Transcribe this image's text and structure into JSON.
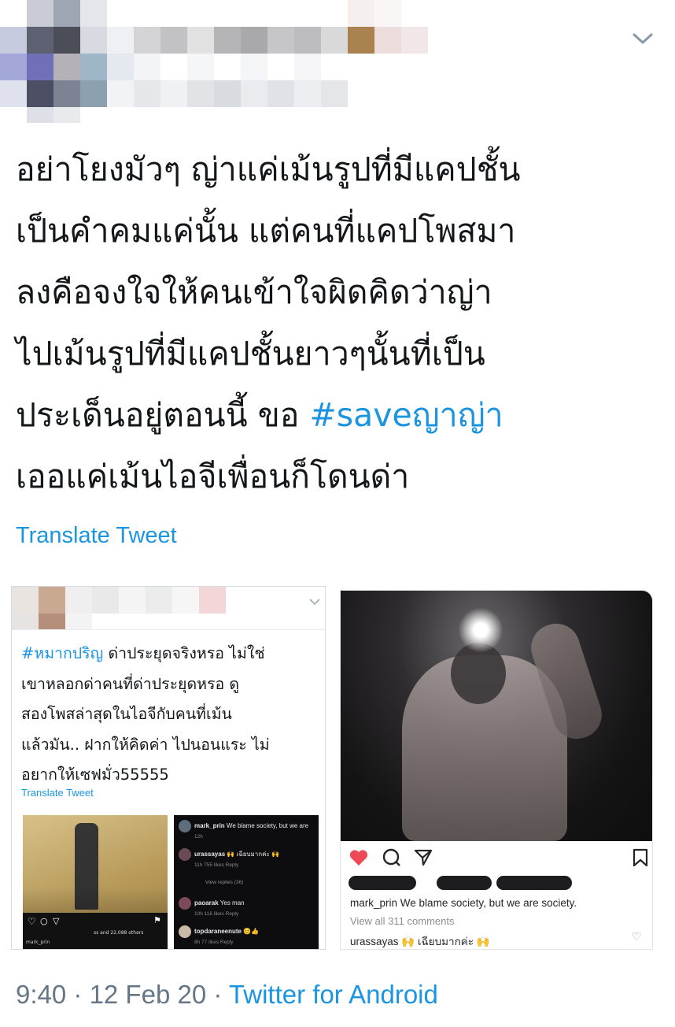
{
  "tweet": {
    "lines": [
      "อย่าโยงมัวๆ ญ่าแค่เม้นรูปที่มีแคปชั้น",
      "เป็นคำคมแค่นั้น แต่คนที่แคปโพสมา",
      "ลงคือจงใจให้คนเข้าใจผิดคิดว่าญ่า",
      "ไปเม้นรูปที่มีแคปชั้นยาวๆนั้นที่เป็น",
      "ประเด็นอยู่ตอนนี้ ขอ ",
      "เออแค่เม้นไอจีเพื่อนก็โดนด่า"
    ],
    "hashtag": "#saveญาญ่า",
    "translate_label": "Translate Tweet",
    "time": "9:40",
    "sep1": " · ",
    "date": "12 Feb 20",
    "sep2": " · ",
    "source": "Twitter for Android"
  },
  "embedded_tweet": {
    "hashtag": "#หมากปริญ",
    "line1_rest": " ด่าประยุดจริงหรอ ไม่ใช่",
    "lines": [
      "เขาหลอกด่าคนที่ด่าประยุดหรอ ดู",
      "สองโพสล่าสุดในไอจีกับคนที่เม้น",
      "แล้วมัน.. ฝากให้คิดค่า ไปนอนแระ ไม่",
      "อยากให้เซฟมั่ว55555"
    ],
    "translate_label": "Translate Tweet",
    "thumb1_likes": "ss and 22,088 others",
    "thumb1_caption": "mark_prin",
    "comments": [
      {
        "user": "mark_prin",
        "text": "We blame society, but we are",
        "meta": "12h"
      },
      {
        "user": "urassayas",
        "text": "🙌 เฉียบมากค่ะ 🙌",
        "meta": "11h   755 likes   Reply"
      },
      {
        "user": "",
        "text": "View replies (36)",
        "meta": ""
      },
      {
        "user": "paoarak",
        "text": "Yes man",
        "meta": "10h   116 likes   Reply"
      },
      {
        "user": "topdaraneenute",
        "text": "😊👍",
        "meta": "8h   77 likes   Reply"
      }
    ]
  },
  "instagram_post": {
    "caption_user": "mark_prin",
    "caption_text": "We blame society, but we are society.",
    "view_all": "View all 311 comments",
    "comment_user": "urassayas",
    "comment_text": "🙌 เฉียบมากค่ะ 🙌",
    "heart_color": "#ed4956"
  },
  "colors": {
    "link": "#1b95e0",
    "text": "#14171a",
    "muted": "#657786"
  }
}
